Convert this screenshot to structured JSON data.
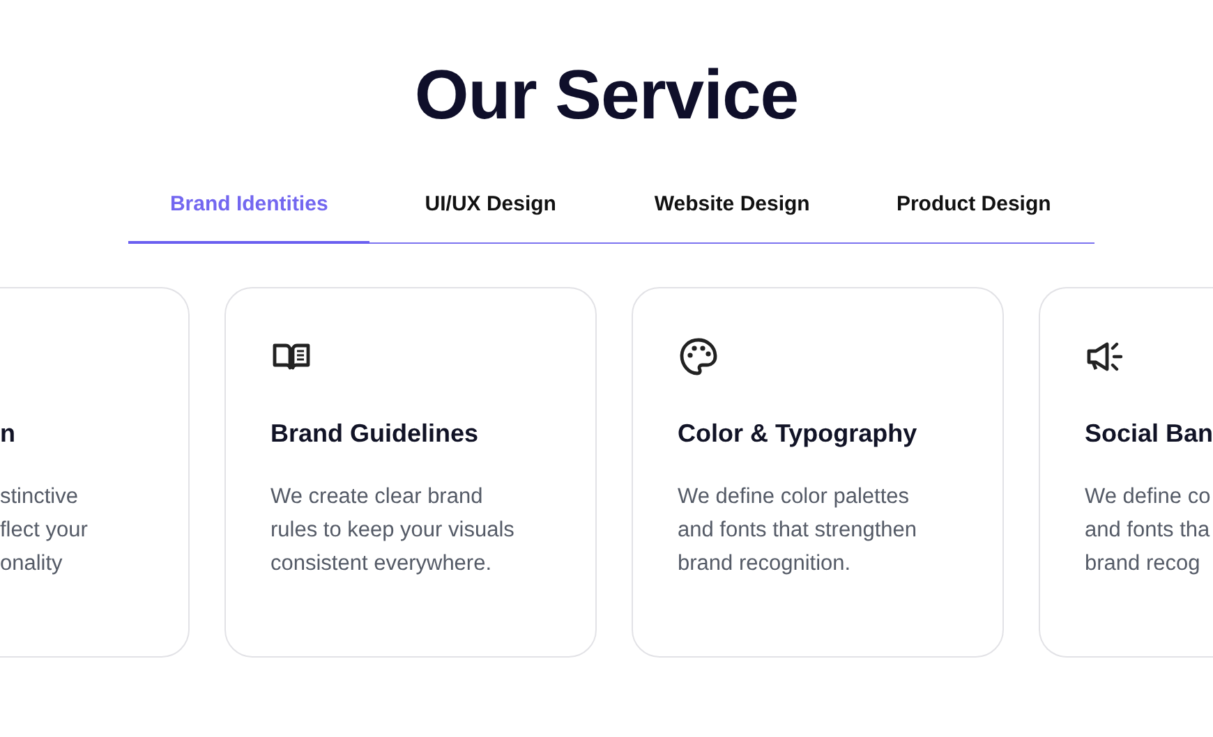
{
  "heading": "Our Service",
  "tabs": [
    {
      "label": "Brand Identities",
      "selected": true
    },
    {
      "label": "UI/UX Design",
      "selected": false
    },
    {
      "label": "Website Design",
      "selected": false
    },
    {
      "label": "Product Design",
      "selected": false
    }
  ],
  "cards": [
    {
      "kind": "cut-left",
      "title": "n",
      "lines": [
        "stinctive",
        "flect your",
        "onality"
      ]
    },
    {
      "kind": "full",
      "title": "Brand Guidelines",
      "lines": [
        "We create clear brand",
        "rules to keep your visuals",
        "consistent everywhere."
      ]
    },
    {
      "kind": "full",
      "title": "Color & Typography",
      "lines": [
        "We define color palettes",
        "and fonts that strengthen",
        "brand recognition."
      ]
    },
    {
      "kind": "cut-right",
      "title": "Social Ban",
      "lines": [
        "We define co",
        "and fonts tha",
        "brand recog"
      ]
    }
  ]
}
